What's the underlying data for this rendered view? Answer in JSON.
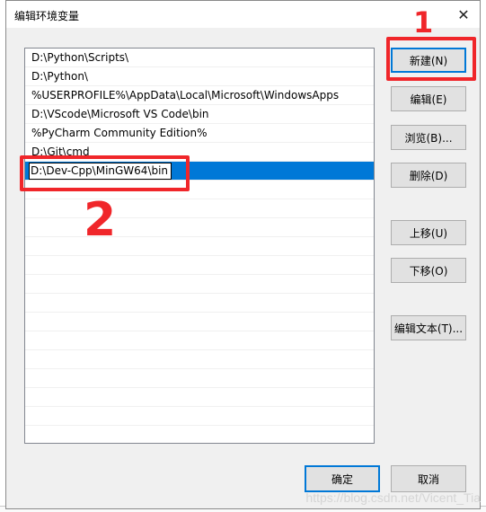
{
  "dialog": {
    "title": "编辑环境变量",
    "close_glyph": "✕"
  },
  "path_list": {
    "entries": [
      "D:\\Python\\Scripts\\",
      "D:\\Python\\",
      "%USERPROFILE%\\AppData\\Local\\Microsoft\\WindowsApps",
      "D:\\VScode\\Microsoft VS Code\\bin",
      "%PyCharm Community Edition%",
      "D:\\Git\\cmd"
    ],
    "editing_value": "D:\\Dev-Cpp\\MinGW64\\bin"
  },
  "buttons": {
    "new": "新建(N)",
    "edit": "编辑(E)",
    "browse": "浏览(B)...",
    "delete": "删除(D)",
    "move_up": "上移(U)",
    "move_down": "下移(O)",
    "edit_text": "编辑文本(T)...",
    "ok": "确定",
    "cancel": "取消"
  },
  "annotations": {
    "mark_1": "1",
    "mark_2": "2",
    "color": "#f0262a"
  },
  "watermark": "https://blog.csdn.net/Vicent_Tia",
  "colors": {
    "selection": "#0078d7",
    "dialog_bg": "#f0f0f0"
  }
}
